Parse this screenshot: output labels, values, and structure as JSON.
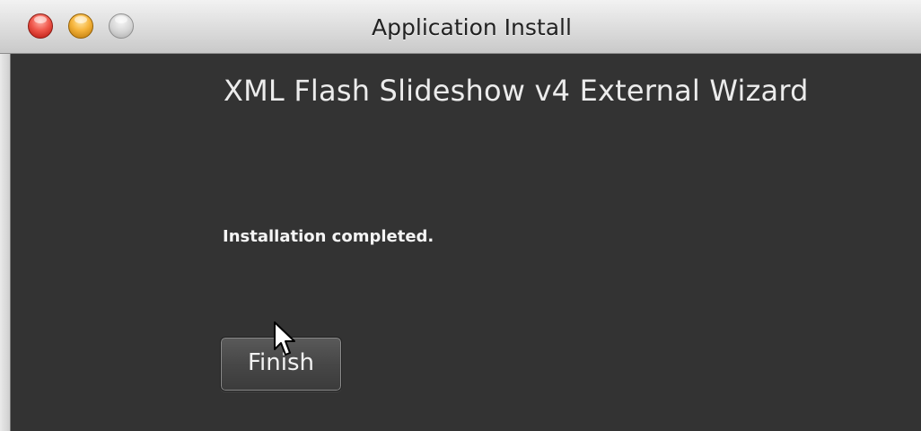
{
  "window": {
    "title": "Application Install"
  },
  "wizard": {
    "heading": "XML Flash Slideshow v4 External Wizard",
    "status": "Installation completed.",
    "finish_label": "Finish"
  },
  "icons": {
    "close": "close-traffic-light-icon",
    "minimize": "minimize-traffic-light-icon",
    "zoom": "zoom-traffic-light-icon",
    "cursor": "mouse-pointer-icon"
  },
  "colors": {
    "content_background": "#333333",
    "close_button": "#f0584c",
    "minimize_button": "#f6b43b",
    "zoom_button": "#d4d4d4"
  }
}
